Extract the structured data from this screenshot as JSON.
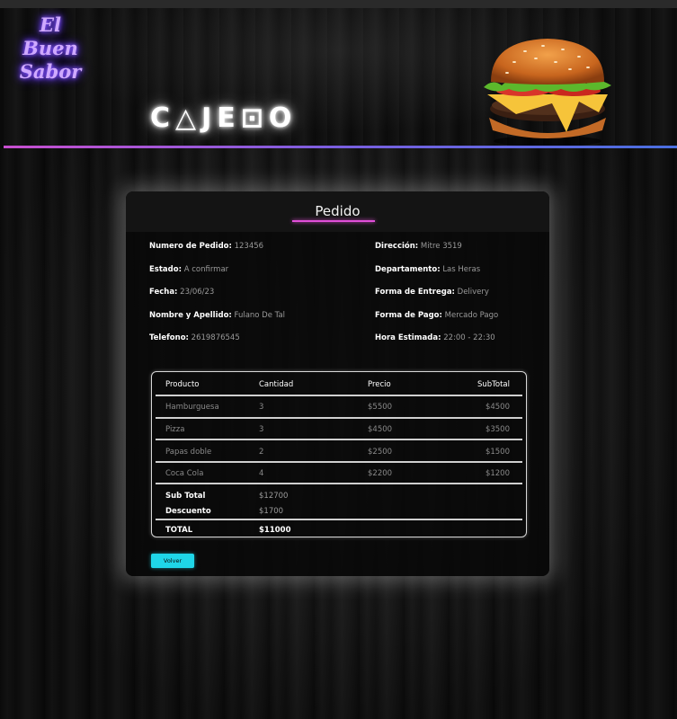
{
  "header": {
    "logo_line1": "El Buen",
    "logo_line2": "Sabor",
    "section_title": "C△JE⊡O"
  },
  "order": {
    "title": "Pedido",
    "left_fields": [
      {
        "label": "Numero de Pedido:",
        "value": "123456"
      },
      {
        "label": "Estado:",
        "value": "A confirmar"
      },
      {
        "label": "Fecha:",
        "value": "23/06/23"
      },
      {
        "label": "Nombre y Apellido:",
        "value": "Fulano De Tal"
      },
      {
        "label": "Telefono:",
        "value": "2619876545"
      }
    ],
    "right_fields": [
      {
        "label": "Dirección:",
        "value": "Mitre 3519"
      },
      {
        "label": "Departamento:",
        "value": "Las Heras"
      },
      {
        "label": "Forma de Entrega:",
        "value": "Delivery"
      },
      {
        "label": "Forma de Pago:",
        "value": "Mercado Pago"
      },
      {
        "label": "Hora Estimada:",
        "value": "22:00 - 22:30"
      }
    ]
  },
  "table": {
    "columns": [
      "Producto",
      "Cantidad",
      "Precio",
      "SubTotal"
    ],
    "rows": [
      [
        "Hamburguesa",
        "3",
        "$5500",
        "$4500"
      ],
      [
        "Pizza",
        "3",
        "$4500",
        "$3500"
      ],
      [
        "Papas doble",
        "2",
        "$2500",
        "$1500"
      ],
      [
        "Coca Cola",
        "4",
        "$2200",
        "$1200"
      ]
    ],
    "subtotal_label": "Sub Total",
    "subtotal_value": "$12700",
    "discount_label": "Descuento",
    "discount_value": "$1700",
    "total_label": "TOTAL",
    "total_value": "$11000"
  },
  "actions": {
    "back_label": "Volver"
  },
  "colors": {
    "accent_pink": "#e04fd8",
    "button_cyan": "#1fd6e8",
    "logo_purple": "#8c5cff"
  }
}
